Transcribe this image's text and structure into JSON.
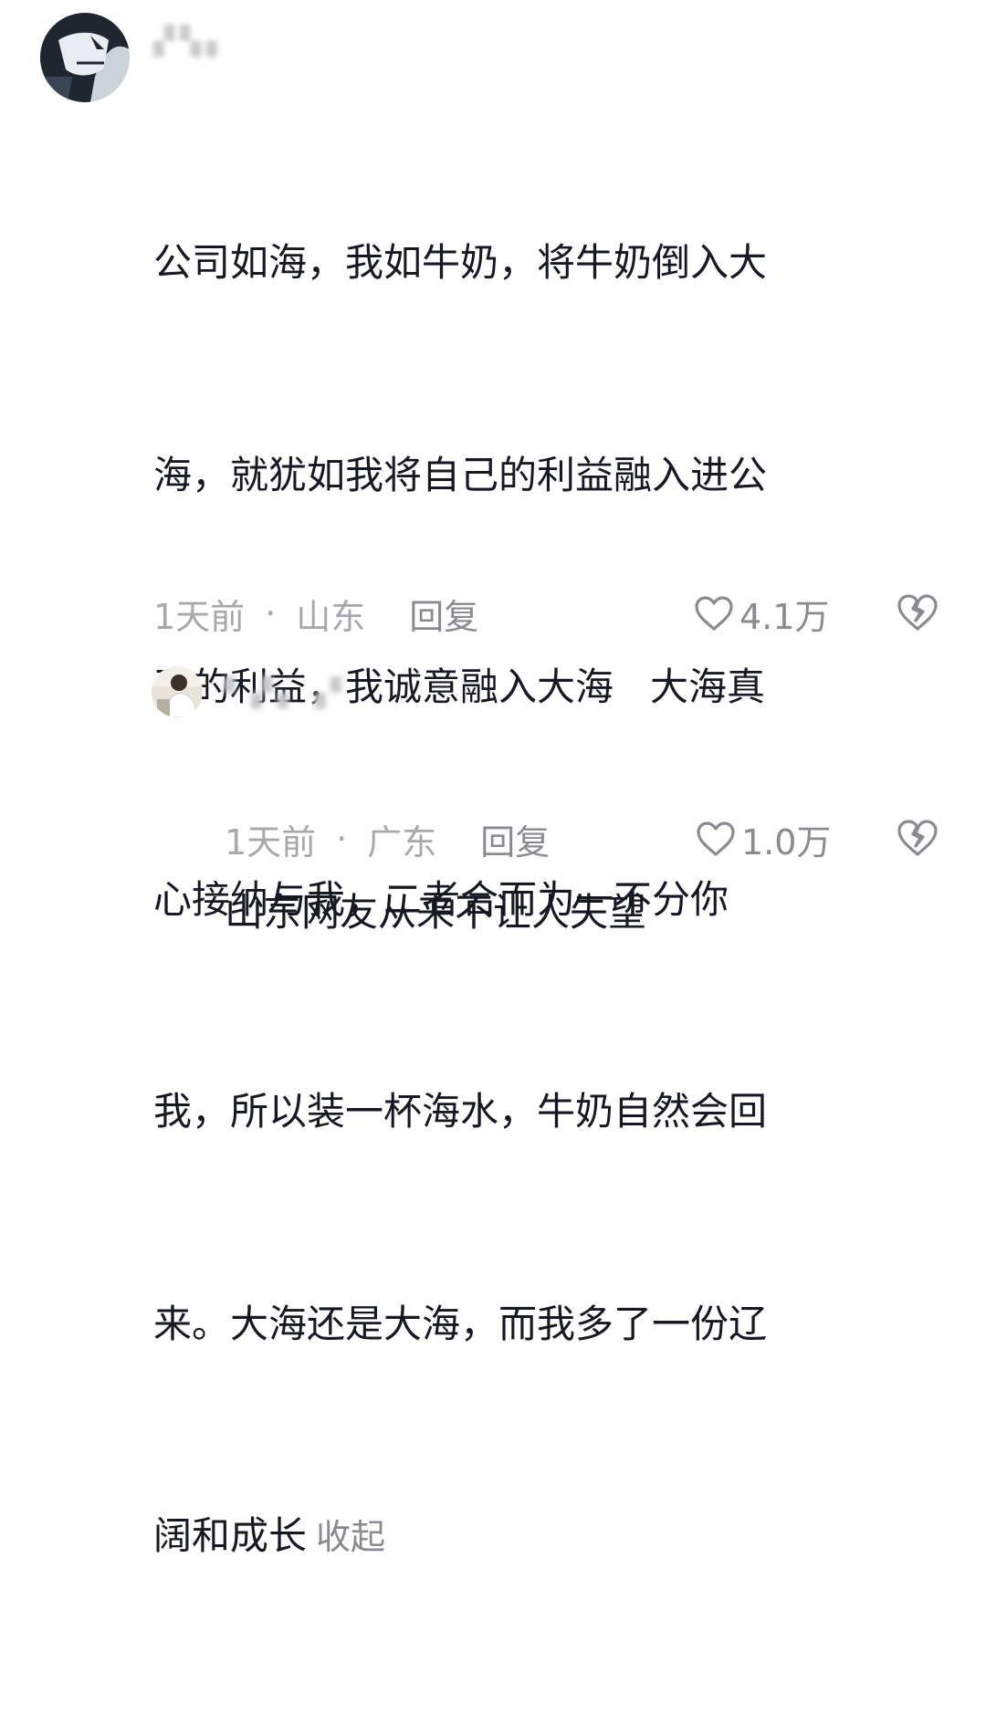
{
  "main_comment": {
    "text_lines": [
      "公司如海，我如牛奶，将牛奶倒入大",
      "海，就犹如我将自己的利益融入进公",
      "司的利益，我诚意融入大海   大海真",
      "心接纳与我，二者合而为一不分你",
      "我，所以装一杯海水，牛奶自然会回",
      "来。大海还是大海，而我多了一份辽",
      "阔和成长"
    ],
    "collapse_label": "收起",
    "time": "1天前",
    "separator": "·",
    "location": "山东",
    "reply_label": "回复",
    "like_count": "4.1万",
    "like_icon": "heart-outline-icon",
    "dislike_icon": "broken-heart-icon"
  },
  "reply_comment": {
    "text": "山东网友从来不让人失望",
    "time": "1天前",
    "separator": "·",
    "location": "广东",
    "reply_label": "回复",
    "like_count": "1.0万",
    "like_icon": "heart-outline-icon",
    "dislike_icon": "broken-heart-icon"
  },
  "colors": {
    "text_primary": "#161823",
    "text_secondary": "#8a8b91",
    "text_tertiary": "#a7a8ac"
  }
}
